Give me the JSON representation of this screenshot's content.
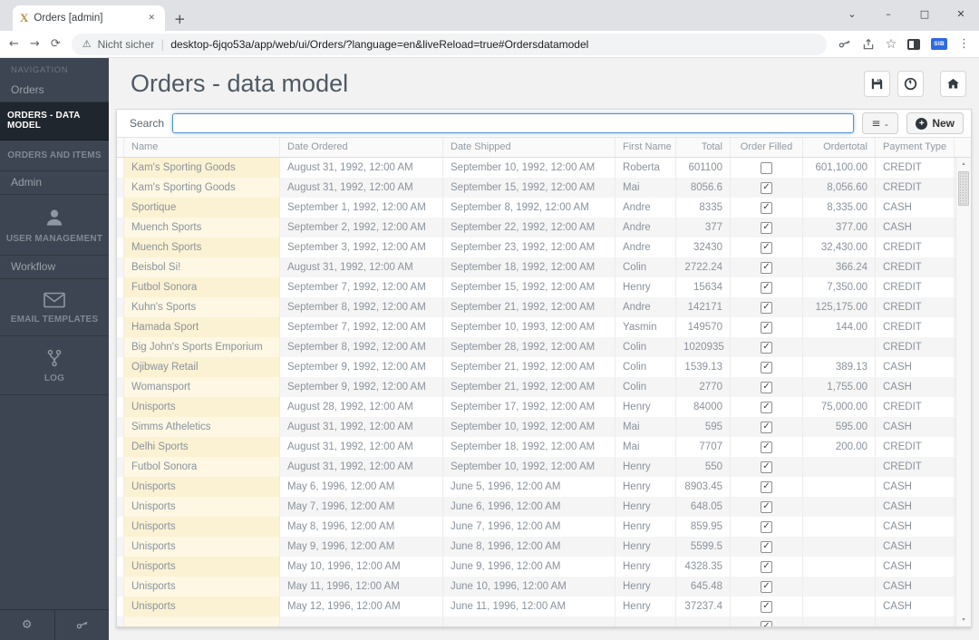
{
  "browser": {
    "favicon_letter": "X",
    "tab_title": "Orders [admin]",
    "security_label": "Nicht sicher",
    "url": "desktop-6jqo53a/app/web/ui/Orders/?language=en&liveReload=true#Ordersdatamodel",
    "extension_badge": "SIB"
  },
  "icons": {
    "back": "←",
    "forward": "→",
    "reload": "⟳",
    "warning": "⚠",
    "star": "☆",
    "kebab": "⋮",
    "window_chevron": "⌄",
    "minimize": "–",
    "maximize": "□",
    "close": "✕",
    "tab_close": "✕",
    "new_tab_plus": "+",
    "url_divider": "|",
    "hamburger": "≡",
    "chevron_small": "⌄",
    "new_plus": "+",
    "gear": "⚙",
    "check": "✓",
    "scroll_up": "▴",
    "scroll_down": "▾"
  },
  "sidebar": {
    "nav_header": "NAVIGATION",
    "items": [
      {
        "label": "Orders",
        "type": "section"
      },
      {
        "label": "ORDERS - DATA MODEL",
        "type": "item",
        "active": true
      },
      {
        "label": "ORDERS AND ITEMS",
        "type": "item"
      },
      {
        "label": "Admin",
        "type": "section"
      },
      {
        "label": "USER MANAGEMENT",
        "type": "item",
        "icon": "user-icon"
      },
      {
        "label": "Workflow",
        "type": "section"
      },
      {
        "label": "EMAIL TEMPLATES",
        "type": "item",
        "icon": "envelope-icon"
      },
      {
        "label": "LOG",
        "type": "item",
        "icon": "branch-icon"
      }
    ]
  },
  "header": {
    "title": "Orders - data model"
  },
  "toolbar": {
    "search_label": "Search",
    "search_value": "",
    "new_label": "New"
  },
  "colors": {
    "sidebar_bg": "#3c4551",
    "active_item_bg": "#20262d",
    "name_cell_cream": "#fbf2d3",
    "focus_blue": "#4f90d0",
    "extension_badge_blue": "#2d6ae3"
  },
  "table": {
    "columns": [
      "Name",
      "Date Ordered",
      "Date Shipped",
      "First Name",
      "Total",
      "Order Filled",
      "Ordertotal",
      "Payment Type"
    ],
    "rows": [
      {
        "name": "Kam's Sporting Goods",
        "date_ordered": "August 31, 1992, 12:00 AM",
        "date_shipped": "September 10, 1992, 12:00 AM",
        "first_name": "Roberta",
        "total": "601100",
        "order_filled": false,
        "ordertotal": "601,100.00",
        "payment_type": "CREDIT"
      },
      {
        "name": "Kam's Sporting Goods",
        "date_ordered": "August 31, 1992, 12:00 AM",
        "date_shipped": "September 15, 1992, 12:00 AM",
        "first_name": "Mai",
        "total": "8056.6",
        "order_filled": true,
        "ordertotal": "8,056.60",
        "payment_type": "CREDIT"
      },
      {
        "name": "Sportique",
        "date_ordered": "September 1, 1992, 12:00 AM",
        "date_shipped": "September 8, 1992, 12:00 AM",
        "first_name": "Andre",
        "total": "8335",
        "order_filled": true,
        "ordertotal": "8,335.00",
        "payment_type": "CASH"
      },
      {
        "name": "Muench Sports",
        "date_ordered": "September 2, 1992, 12:00 AM",
        "date_shipped": "September 22, 1992, 12:00 AM",
        "first_name": "Andre",
        "total": "377",
        "order_filled": true,
        "ordertotal": "377.00",
        "payment_type": "CASH"
      },
      {
        "name": "Muench Sports",
        "date_ordered": "September 3, 1992, 12:00 AM",
        "date_shipped": "September 23, 1992, 12:00 AM",
        "first_name": "Andre",
        "total": "32430",
        "order_filled": true,
        "ordertotal": "32,430.00",
        "payment_type": "CREDIT"
      },
      {
        "name": "Beisbol Si!",
        "date_ordered": "August 31, 1992, 12:00 AM",
        "date_shipped": "September 18, 1992, 12:00 AM",
        "first_name": "Colin",
        "total": "2722.24",
        "order_filled": true,
        "ordertotal": "366.24",
        "payment_type": "CREDIT"
      },
      {
        "name": "Futbol Sonora",
        "date_ordered": "September 7, 1992, 12:00 AM",
        "date_shipped": "September 15, 1992, 12:00 AM",
        "first_name": "Henry",
        "total": "15634",
        "order_filled": true,
        "ordertotal": "7,350.00",
        "payment_type": "CREDIT"
      },
      {
        "name": "Kuhn's Sports",
        "date_ordered": "September 8, 1992, 12:00 AM",
        "date_shipped": "September 21, 1992, 12:00 AM",
        "first_name": "Andre",
        "total": "142171",
        "order_filled": true,
        "ordertotal": "125,175.00",
        "payment_type": "CREDIT"
      },
      {
        "name": "Hamada Sport",
        "date_ordered": "September 7, 1992, 12:00 AM",
        "date_shipped": "September 10, 1993, 12:00 AM",
        "first_name": "Yasmin",
        "total": "149570",
        "order_filled": true,
        "ordertotal": "144.00",
        "payment_type": "CREDIT"
      },
      {
        "name": "Big John's Sports Emporium",
        "date_ordered": "September 8, 1992, 12:00 AM",
        "date_shipped": "September 28, 1992, 12:00 AM",
        "first_name": "Colin",
        "total": "1020935",
        "order_filled": true,
        "ordertotal": "",
        "payment_type": "CREDIT"
      },
      {
        "name": "Ojibway Retail",
        "date_ordered": "September 9, 1992, 12:00 AM",
        "date_shipped": "September 21, 1992, 12:00 AM",
        "first_name": "Colin",
        "total": "1539.13",
        "order_filled": true,
        "ordertotal": "389.13",
        "payment_type": "CASH"
      },
      {
        "name": "Womansport",
        "date_ordered": "September 9, 1992, 12:00 AM",
        "date_shipped": "September 21, 1992, 12:00 AM",
        "first_name": "Colin",
        "total": "2770",
        "order_filled": true,
        "ordertotal": "1,755.00",
        "payment_type": "CASH"
      },
      {
        "name": "Unisports",
        "date_ordered": "August 28, 1992, 12:00 AM",
        "date_shipped": "September 17, 1992, 12:00 AM",
        "first_name": "Henry",
        "total": "84000",
        "order_filled": true,
        "ordertotal": "75,000.00",
        "payment_type": "CREDIT"
      },
      {
        "name": "Simms Atheletics",
        "date_ordered": "August 31, 1992, 12:00 AM",
        "date_shipped": "September 10, 1992, 12:00 AM",
        "first_name": "Mai",
        "total": "595",
        "order_filled": true,
        "ordertotal": "595.00",
        "payment_type": "CASH"
      },
      {
        "name": "Delhi Sports",
        "date_ordered": "August 31, 1992, 12:00 AM",
        "date_shipped": "September 18, 1992, 12:00 AM",
        "first_name": "Mai",
        "total": "7707",
        "order_filled": true,
        "ordertotal": "200.00",
        "payment_type": "CREDIT"
      },
      {
        "name": "Futbol Sonora",
        "date_ordered": "August 31, 1992, 12:00 AM",
        "date_shipped": "September 10, 1992, 12:00 AM",
        "first_name": "Henry",
        "total": "550",
        "order_filled": true,
        "ordertotal": "",
        "payment_type": "CREDIT"
      },
      {
        "name": "Unisports",
        "date_ordered": "May 6, 1996, 12:00 AM",
        "date_shipped": "June 5, 1996, 12:00 AM",
        "first_name": "Henry",
        "total": "8903.45",
        "order_filled": true,
        "ordertotal": "",
        "payment_type": "CASH"
      },
      {
        "name": "Unisports",
        "date_ordered": "May 7, 1996, 12:00 AM",
        "date_shipped": "June 6, 1996, 12:00 AM",
        "first_name": "Henry",
        "total": "648.05",
        "order_filled": true,
        "ordertotal": "",
        "payment_type": "CASH"
      },
      {
        "name": "Unisports",
        "date_ordered": "May 8, 1996, 12:00 AM",
        "date_shipped": "June 7, 1996, 12:00 AM",
        "first_name": "Henry",
        "total": "859.95",
        "order_filled": true,
        "ordertotal": "",
        "payment_type": "CASH"
      },
      {
        "name": "Unisports",
        "date_ordered": "May 9, 1996, 12:00 AM",
        "date_shipped": "June 8, 1996, 12:00 AM",
        "first_name": "Henry",
        "total": "5599.5",
        "order_filled": true,
        "ordertotal": "",
        "payment_type": "CASH"
      },
      {
        "name": "Unisports",
        "date_ordered": "May 10, 1996, 12:00 AM",
        "date_shipped": "June 9, 1996, 12:00 AM",
        "first_name": "Henry",
        "total": "4328.35",
        "order_filled": true,
        "ordertotal": "",
        "payment_type": "CASH"
      },
      {
        "name": "Unisports",
        "date_ordered": "May 11, 1996, 12:00 AM",
        "date_shipped": "June 10, 1996, 12:00 AM",
        "first_name": "Henry",
        "total": "645.48",
        "order_filled": true,
        "ordertotal": "",
        "payment_type": "CASH"
      },
      {
        "name": "Unisports",
        "date_ordered": "May 12, 1996, 12:00 AM",
        "date_shipped": "June 11, 1996, 12:00 AM",
        "first_name": "Henry",
        "total": "37237.4",
        "order_filled": true,
        "ordertotal": "",
        "payment_type": "CASH"
      }
    ],
    "partial_row": {
      "name": "",
      "date_ordered": "",
      "date_shipped": "",
      "first_name": "",
      "total": "",
      "order_filled": true,
      "ordertotal": "",
      "payment_type": ""
    }
  }
}
